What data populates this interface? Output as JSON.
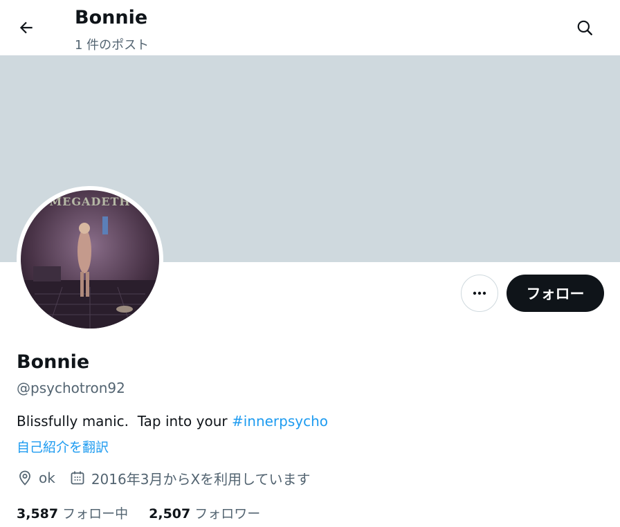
{
  "header": {
    "title": "Bonnie",
    "post_count": "1 件のポスト",
    "back_icon": "arrow-left-icon",
    "search_icon": "search-icon"
  },
  "banner": {
    "color": "#cfd9de"
  },
  "profile": {
    "display_name": "Bonnie",
    "handle": "@psychotron92",
    "bio_text": "Blissfully manic.  Tap into your ",
    "bio_hashtag": "#innerpsycho",
    "translate_label": "自己紹介を翻訳",
    "avatar_logo_text": "MEGADETH",
    "location": "ok",
    "joined": "2016年3月からXを利用しています",
    "follow_label": "フォロー",
    "more_icon": "more-horizontal-icon"
  },
  "stats": {
    "following_count": "3,587",
    "following_label": "フォロー中",
    "followers_count": "2,507",
    "followers_label": "フォロワー"
  },
  "colors": {
    "accent": "#1d9bf0",
    "text_primary": "#0f1419",
    "text_secondary": "#536471",
    "button_dark": "#0f1419"
  }
}
